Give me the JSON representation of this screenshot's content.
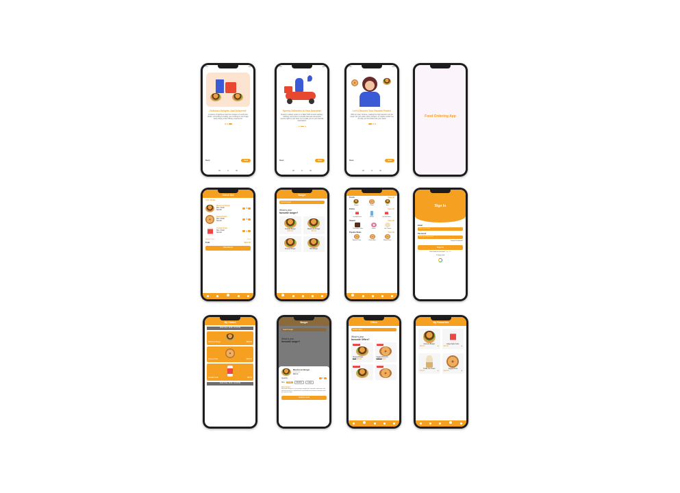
{
  "onboarding": [
    {
      "title": "Delicious Delights Just Delivered!",
      "text": "A variety of delicious food from burgers to sushi and drinks, everything to satisfy your cravings is one finger away. Enjoy a full culinary experience!",
      "skip": "Back",
      "next": "Next"
    },
    {
      "title": "Speedy Deliveries to Your Doorstep!",
      "text": "Ready to deliver orders in a flash! With smooth delivery tracking, we're here to provide fast and convenient service right to your door. Let us take you to your favorite destination!",
      "skip": "Back",
      "next": "Next"
    },
    {
      "title": "Let's Discover Your Favorite Foods!",
      "text": "With so many choices, making the right decision can be tough. Do you prefer pizza, burgers, or maybe sushi? Let us help you find what suits your taste!",
      "skip": "Back",
      "next": "Next"
    }
  ],
  "splash": {
    "title": "Food Ordering App"
  },
  "checkout": {
    "header": "Check Out",
    "section": "Your Order",
    "items": [
      {
        "name": "Mushroom Burger",
        "line1": "Size: Small",
        "line2": "Special",
        "qty": "1"
      },
      {
        "name": "Seafood Pizza",
        "line1": "Size: Small",
        "line2": "Special",
        "qty": "1"
      },
      {
        "name": "Cocktail Small",
        "line1": "Size: Small",
        "line2": "Special",
        "qty": "1"
      }
    ],
    "delivery_label": "Delivery Fee",
    "delivery_value": "Free",
    "total_label": "Total",
    "total_value": "$250.00",
    "button": "Checkout"
  },
  "burger_list": {
    "header": "Burger",
    "search": "Search burger",
    "heading_line1": "What is your",
    "heading_line2": "favourite burger?",
    "items": [
      {
        "name": "Cocktail Burger",
        "price": "$125.00"
      },
      {
        "name": "Mushroom Burger",
        "price": "$90.00"
      },
      {
        "name": "Cheese Burger",
        "price": ""
      },
      {
        "name": "Mini Burger",
        "price": ""
      }
    ]
  },
  "categories": {
    "sections": [
      {
        "title": "Foods",
        "action": "View All",
        "items": [
          "Burger",
          "Pizza",
          "Taco"
        ]
      },
      {
        "title": "Drinks",
        "action": "View All",
        "items": [
          "Cocktail Juice",
          "Water",
          "Cocktail Juice"
        ]
      },
      {
        "title": "Sweets",
        "action": "View All",
        "items": [
          "Chocolate Cake",
          "Donut",
          "Ice Cream"
        ]
      },
      {
        "title": "Popular Meals",
        "action": "View All",
        "items": [
          "Special Pizza",
          "Pizza Slice",
          "Mixed Pizza"
        ]
      }
    ]
  },
  "signin": {
    "title": "Sign In",
    "email_label": "Email",
    "email_placeholder": "Enter your Email",
    "password_label": "Password",
    "password_placeholder": "Enter your Password",
    "forgot": "Forget Password?",
    "button": "Sign In",
    "signup_prompt": "Don't have an account?",
    "signup_link": "Sign Up",
    "or": "Or login with"
  },
  "my_orders": {
    "header": "My Orders",
    "time_strip": "Order Time: 19:06 - 01:11 PM",
    "items": [
      {
        "name": "Mushroom Burger",
        "price": "$250.00"
      },
      {
        "name": "Cheese Pizza",
        "price": "$350.00"
      },
      {
        "name": "Cocktail Small",
        "price": "$80.00"
      }
    ],
    "time_strip_2": "Order Time: 19:09 - 02:30 PM"
  },
  "detail": {
    "header": "Burger",
    "search": "Search burger",
    "heading_line1": "What is your",
    "heading_line2": "favourite burger?",
    "name": "Mushroom Burger",
    "price": "$90.00",
    "qty_label": "Quantity",
    "qty": "1",
    "size_label": "Size",
    "sizes": [
      "Small",
      "Medium",
      "Large"
    ],
    "desc_label": "Description",
    "desc": "Mushroom Burger is a juicy burger topped with sauteed mushrooms and melted cheese on a toasted bun, served with fresh lettuce, tomatoes and our special sauce.",
    "button": "Add to Cart"
  },
  "offers": {
    "header": "Offers",
    "search": "Search offers",
    "heading_line1": "What is your",
    "heading_line2": "favourite Offers?",
    "items": [
      {
        "name": "Cheese Burger",
        "old": "$160",
        "new": "$90.00",
        "badge": "15% OFF"
      },
      {
        "name": "Veggie Pizza (S)",
        "old": "$180.00",
        "new": "$125",
        "badge": "20% OFF"
      },
      {
        "name": "",
        "old": "",
        "new": "",
        "badge": "15% OFF"
      },
      {
        "name": "",
        "old": "",
        "new": "",
        "badge": "15% OFF"
      }
    ]
  },
  "favourites": {
    "header": "My Favourites",
    "items": [
      {
        "name": "Gourmet Burger",
        "price": "$90.00"
      },
      {
        "name": "Large Apple Juice",
        "price": "$45.00"
      },
      {
        "name": "Truffle Ice Cream",
        "price": "$35.00"
      },
      {
        "name": "Veggie Pizza",
        "price": "$100.00"
      }
    ]
  }
}
